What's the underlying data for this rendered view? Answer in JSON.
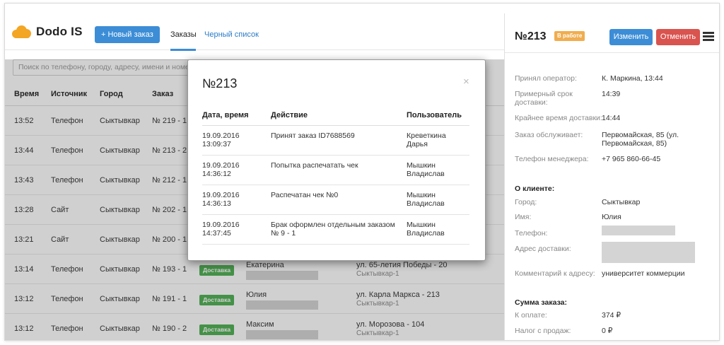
{
  "app": {
    "logo_text": "Dodo IS"
  },
  "nav": {
    "new_order_label": "+ Новый заказ",
    "tab_orders": "Заказы",
    "tab_blacklist": "Черный список"
  },
  "search": {
    "placeholder": "Поиск по телефону, городу, адресу, имени и номер"
  },
  "table": {
    "headers": [
      "Время",
      "Источник",
      "Город",
      "Заказ"
    ],
    "rows": [
      {
        "time": "13:52",
        "source": "Телефон",
        "city": "Сыктывкар",
        "order": "№ 219 - 1"
      },
      {
        "time": "13:44",
        "source": "Телефон",
        "city": "Сыктывкар",
        "order": "№ 213 - 2"
      },
      {
        "time": "13:43",
        "source": "Телефон",
        "city": "Сыктывкар",
        "order": "№ 212 - 1"
      },
      {
        "time": "13:28",
        "source": "Сайт",
        "city": "Сыктывкар",
        "order": "№ 202 - 1"
      },
      {
        "time": "13:21",
        "source": "Сайт",
        "city": "Сыктывкар",
        "order": "№ 200 - 1"
      },
      {
        "time": "13:14",
        "source": "Телефон",
        "city": "Сыктывкар",
        "order": "№ 193 - 1",
        "type": "Доставка",
        "client": "Екатерина",
        "address": "ул. 65-летия Победы - 20",
        "sub": "Сыктывкар-1"
      },
      {
        "time": "13:12",
        "source": "Телефон",
        "city": "Сыктывкар",
        "order": "№ 191 - 1",
        "type": "Доставка",
        "client": "Юлия",
        "address": "ул. Карла Маркса - 213",
        "sub": "Сыктывкар-1"
      },
      {
        "time": "13:12",
        "source": "Телефон",
        "city": "Сыктывкар",
        "order": "№ 190 - 2",
        "type": "Доставка",
        "client": "Максим",
        "address": "ул. Морозова - 104",
        "sub": "Сыктывкар-1"
      }
    ]
  },
  "modal": {
    "title": "№213",
    "close_glyph": "×",
    "headers": [
      "Дата, время",
      "Действие",
      "Пользователь"
    ],
    "rows": [
      {
        "datetime": "19.09.2016\n13:09:37",
        "action": "Принят заказ ID7688569",
        "user": "Креветкина\nДарья"
      },
      {
        "datetime": "19.09.2016\n14:36:12",
        "action": "Попытка распечатать чек",
        "user": "Мышкин\nВладислав"
      },
      {
        "datetime": "19.09.2016\n14:36:13",
        "action": "Распечатан чек №0",
        "user": "Мышкин\nВладислав"
      },
      {
        "datetime": "19.09.2016\n14:37:45",
        "action": "Брак оформлен отдельным заказом\n№ 9 - 1",
        "user": "Мышкин\nВладислав"
      }
    ]
  },
  "details": {
    "order_number": "№213",
    "status": "В работе",
    "edit_label": "Изменить",
    "cancel_label": "Отменить",
    "fields": [
      {
        "label": "Принял оператор:",
        "value": "К. Маркина, 13:44"
      },
      {
        "label": "Примерный срок\nдоставки:",
        "value": "14:39"
      },
      {
        "label": "Крайнее время доставки:",
        "value": "14:44"
      },
      {
        "label": "Заказ обслуживает:",
        "value": "Первомайская, 85 (ул.\nПервомайская, 85)"
      },
      {
        "label": "Телефон менеджера:",
        "value": "+7 965 860-66-45"
      }
    ],
    "client_section": "О клиенте:",
    "client_fields": [
      {
        "label": "Город:",
        "value": "Сыктывкар"
      },
      {
        "label": "Имя:",
        "value": "Юлия"
      },
      {
        "label": "Телефон:",
        "value": ""
      },
      {
        "label": "Адрес доставки:",
        "value": ""
      },
      {
        "label": "Комментарий к адресу:",
        "value": "университет коммерции"
      }
    ],
    "sum_section": "Сумма заказа:",
    "sum_fields": [
      {
        "label": "К оплате:",
        "value": "374 ₽"
      },
      {
        "label": "Налог с продаж:",
        "value": "0 ₽"
      }
    ]
  },
  "colors": {
    "primary": "#3c8dd6",
    "danger": "#d9534f",
    "warning": "#f0ad4e",
    "success": "#4caf50",
    "logo": "#f3a524"
  }
}
